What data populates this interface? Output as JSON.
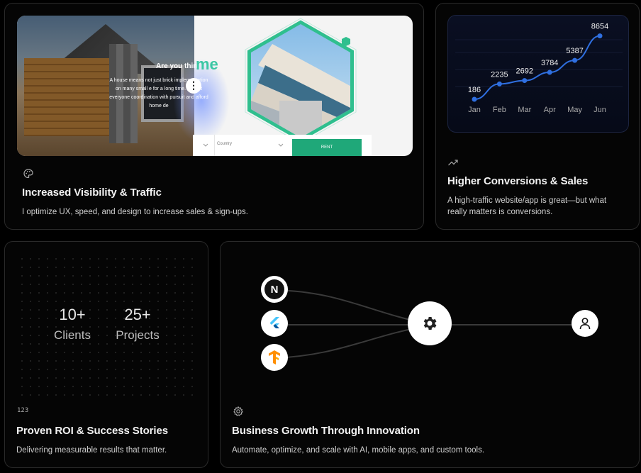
{
  "cards": {
    "visibility": {
      "title": "Increased Visibility & Traffic",
      "description": "I optimize UX, speed, and design to increase sales & sign-ups.",
      "icon": "palette-icon",
      "preview": {
        "hero_title": "Are you thin",
        "hero_text": "A house means not just brick implementation on many small e for a long time. Almost everyone coordination with pursuit and afford home de",
        "brand_fragment": "me",
        "country_placeholder": "Country",
        "rent_label": "RENT",
        "menu_glyph": "⋮"
      }
    },
    "conversions": {
      "title": "Higher Conversions & Sales",
      "description": "A high-traffic website/app is great—but what really matters is conversions.",
      "icon": "trending-up-icon"
    },
    "roi": {
      "title": "Proven ROI & Success Stories",
      "description": "Delivering measurable results that matter.",
      "icon": "numbers-icon",
      "icon_text": "123",
      "stats": [
        {
          "value": "10+",
          "label": "Clients"
        },
        {
          "value": "25+",
          "label": "Projects"
        }
      ]
    },
    "growth": {
      "title": "Business Growth Through Innovation",
      "description": "Automate, optimize, and scale with AI, mobile apps, and custom tools.",
      "icon": "settings-icon",
      "flow_nodes": [
        "nextjs-icon",
        "flutter-icon",
        "tensorflow-icon",
        "gear-icon",
        "user-icon"
      ],
      "nextjs_letter": "N"
    }
  },
  "chart_data": {
    "type": "line",
    "categories": [
      "Jan",
      "Feb",
      "Mar",
      "Apr",
      "May",
      "Jun"
    ],
    "values": [
      186,
      2235,
      2692,
      3784,
      5387,
      8654
    ],
    "title": "",
    "xlabel": "",
    "ylabel": "",
    "ylim": [
      0,
      9000
    ],
    "line_color": "#2f6fe0",
    "grid": true
  },
  "colors": {
    "accent_green": "#3cc7a4",
    "chart_line": "#2f6fe0",
    "card_border": "#2a2a2a"
  }
}
